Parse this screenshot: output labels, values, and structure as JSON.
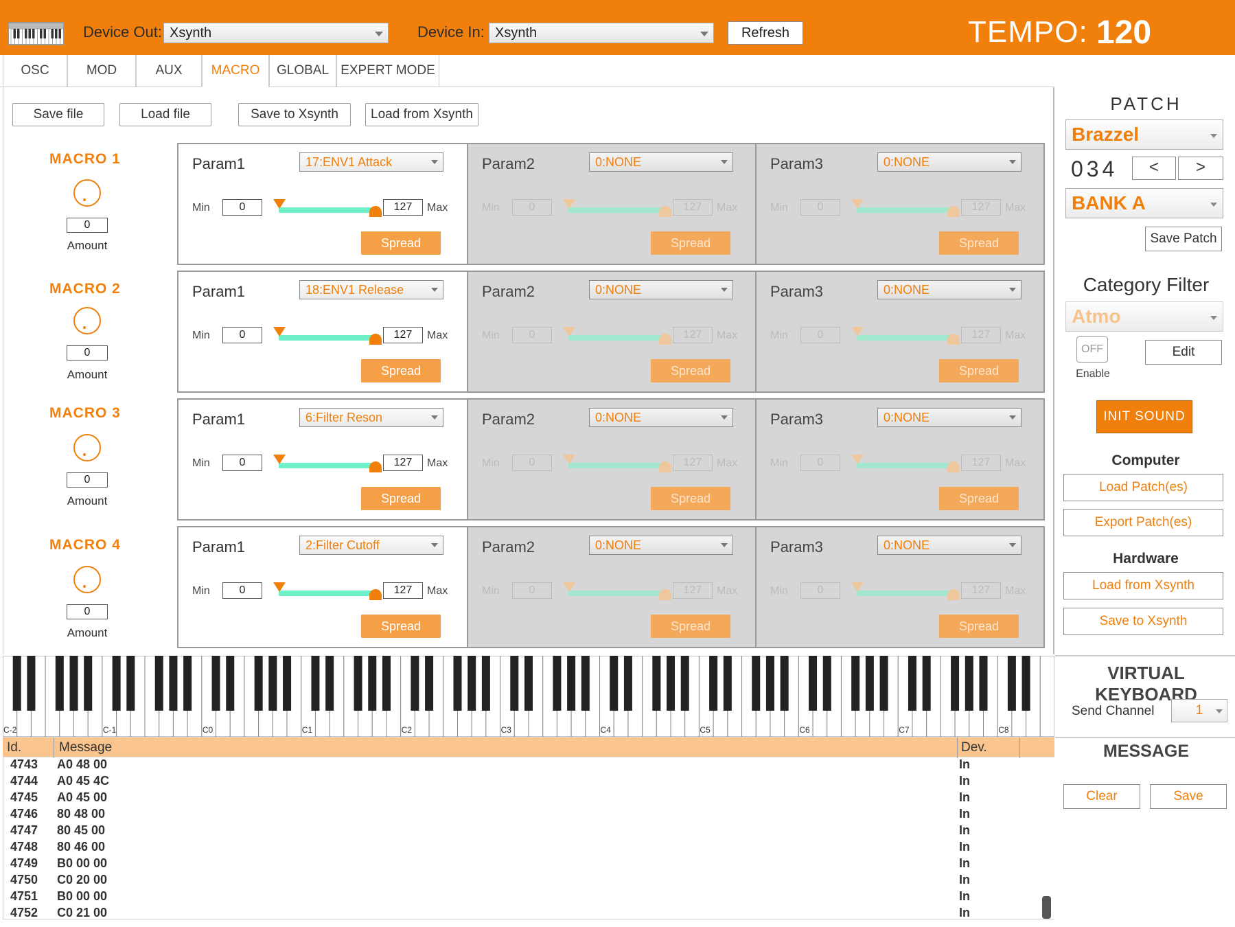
{
  "header": {
    "device_out_label": "Device Out:",
    "device_out_value": "Xsynth",
    "device_in_label": "Device In:",
    "device_in_value": "Xsynth",
    "refresh_label": "Refresh",
    "tempo_label": "TEMPO:",
    "tempo_value": "120"
  },
  "tabs": [
    "OSC",
    "MOD",
    "AUX",
    "MACRO",
    "GLOBAL",
    "EXPERT MODE"
  ],
  "active_tab": "MACRO",
  "toolbar": {
    "save_file": "Save file",
    "load_file": "Load file",
    "save_to_xsynth": "Save to Xsynth",
    "load_from_xsynth": "Load from Xsynth"
  },
  "macros": [
    {
      "title": "MACRO  1",
      "amount": "0",
      "amount_label": "Amount",
      "params": [
        {
          "name": "Param1",
          "select": "17:ENV1 Attack",
          "min_label": "Min",
          "min": "0",
          "max": "127",
          "max_label": "Max",
          "spread": "Spread",
          "enabled": true
        },
        {
          "name": "Param2",
          "select": "0:NONE",
          "min_label": "Min",
          "min": "0",
          "max": "127",
          "max_label": "Max",
          "spread": "Spread",
          "enabled": false
        },
        {
          "name": "Param3",
          "select": "0:NONE",
          "min_label": "Min",
          "min": "0",
          "max": "127",
          "max_label": "Max",
          "spread": "Spread",
          "enabled": false
        }
      ]
    },
    {
      "title": "MACRO  2",
      "amount": "0",
      "amount_label": "Amount",
      "params": [
        {
          "name": "Param1",
          "select": "18:ENV1 Release",
          "min_label": "Min",
          "min": "0",
          "max": "127",
          "max_label": "Max",
          "spread": "Spread",
          "enabled": true
        },
        {
          "name": "Param2",
          "select": "0:NONE",
          "min_label": "Min",
          "min": "0",
          "max": "127",
          "max_label": "Max",
          "spread": "Spread",
          "enabled": false
        },
        {
          "name": "Param3",
          "select": "0:NONE",
          "min_label": "Min",
          "min": "0",
          "max": "127",
          "max_label": "Max",
          "spread": "Spread",
          "enabled": false
        }
      ]
    },
    {
      "title": "MACRO  3",
      "amount": "0",
      "amount_label": "Amount",
      "params": [
        {
          "name": "Param1",
          "select": "6:Filter Reson",
          "min_label": "Min",
          "min": "0",
          "max": "127",
          "max_label": "Max",
          "spread": "Spread",
          "enabled": true
        },
        {
          "name": "Param2",
          "select": "0:NONE",
          "min_label": "Min",
          "min": "0",
          "max": "127",
          "max_label": "Max",
          "spread": "Spread",
          "enabled": false
        },
        {
          "name": "Param3",
          "select": "0:NONE",
          "min_label": "Min",
          "min": "0",
          "max": "127",
          "max_label": "Max",
          "spread": "Spread",
          "enabled": false
        }
      ]
    },
    {
      "title": "MACRO  4",
      "amount": "0",
      "amount_label": "Amount",
      "params": [
        {
          "name": "Param1",
          "select": "2:Filter Cutoff",
          "min_label": "Min",
          "min": "0",
          "max": "127",
          "max_label": "Max",
          "spread": "Spread",
          "enabled": true
        },
        {
          "name": "Param2",
          "select": "0:NONE",
          "min_label": "Min",
          "min": "0",
          "max": "127",
          "max_label": "Max",
          "spread": "Spread",
          "enabled": false
        },
        {
          "name": "Param3",
          "select": "0:NONE",
          "min_label": "Min",
          "min": "0",
          "max": "127",
          "max_label": "Max",
          "spread": "Spread",
          "enabled": false
        }
      ]
    }
  ],
  "patch": {
    "title": "PATCH",
    "name": "Brazzel",
    "number": "034",
    "prev": "<",
    "next": ">",
    "bank": "BANK A",
    "save_patch": "Save Patch",
    "category_filter_title": "Category Filter",
    "category": "Atmo",
    "toggle": "OFF",
    "enable_label": "Enable",
    "edit": "Edit",
    "init_sound": "INIT  SOUND",
    "computer_title": "Computer",
    "load_patches": "Load Patch(es)",
    "export_patches": "Export Patch(es)",
    "hardware_title": "Hardware",
    "load_from_xsynth": "Load from Xsynth",
    "save_to_xsynth": "Save to Xsynth"
  },
  "keyboard": {
    "title": "VIRTUAL KEYBOARD",
    "send_channel_label": "Send Channel",
    "send_channel": "1",
    "octave_labels": [
      "C-2",
      "C-1",
      "C0",
      "C1",
      "C2",
      "C3",
      "C4",
      "C5",
      "C6",
      "C7",
      "C8"
    ]
  },
  "messages": {
    "title": "MESSAGE",
    "clear": "Clear",
    "save": "Save",
    "columns": [
      "Id.",
      "Message",
      "Dev."
    ],
    "rows": [
      [
        "4743",
        "A0 48 00",
        "In"
      ],
      [
        "4744",
        "A0 45 4C",
        "In"
      ],
      [
        "4745",
        "A0 45 00",
        "In"
      ],
      [
        "4746",
        "80 48 00",
        "In"
      ],
      [
        "4747",
        "80 45 00",
        "In"
      ],
      [
        "4748",
        "80 46 00",
        "In"
      ],
      [
        "4749",
        "B0 00 00",
        "In"
      ],
      [
        "4750",
        "C0 20 00",
        "In"
      ],
      [
        "4751",
        "B0 00 00",
        "In"
      ],
      [
        "4752",
        "C0 21 00",
        "In"
      ]
    ]
  },
  "colors": {
    "accent": "#f07f0c",
    "slider_track": "#6ff0c8",
    "disabled_panel": "#d6d6d6",
    "table_header": "#f9c48e"
  }
}
